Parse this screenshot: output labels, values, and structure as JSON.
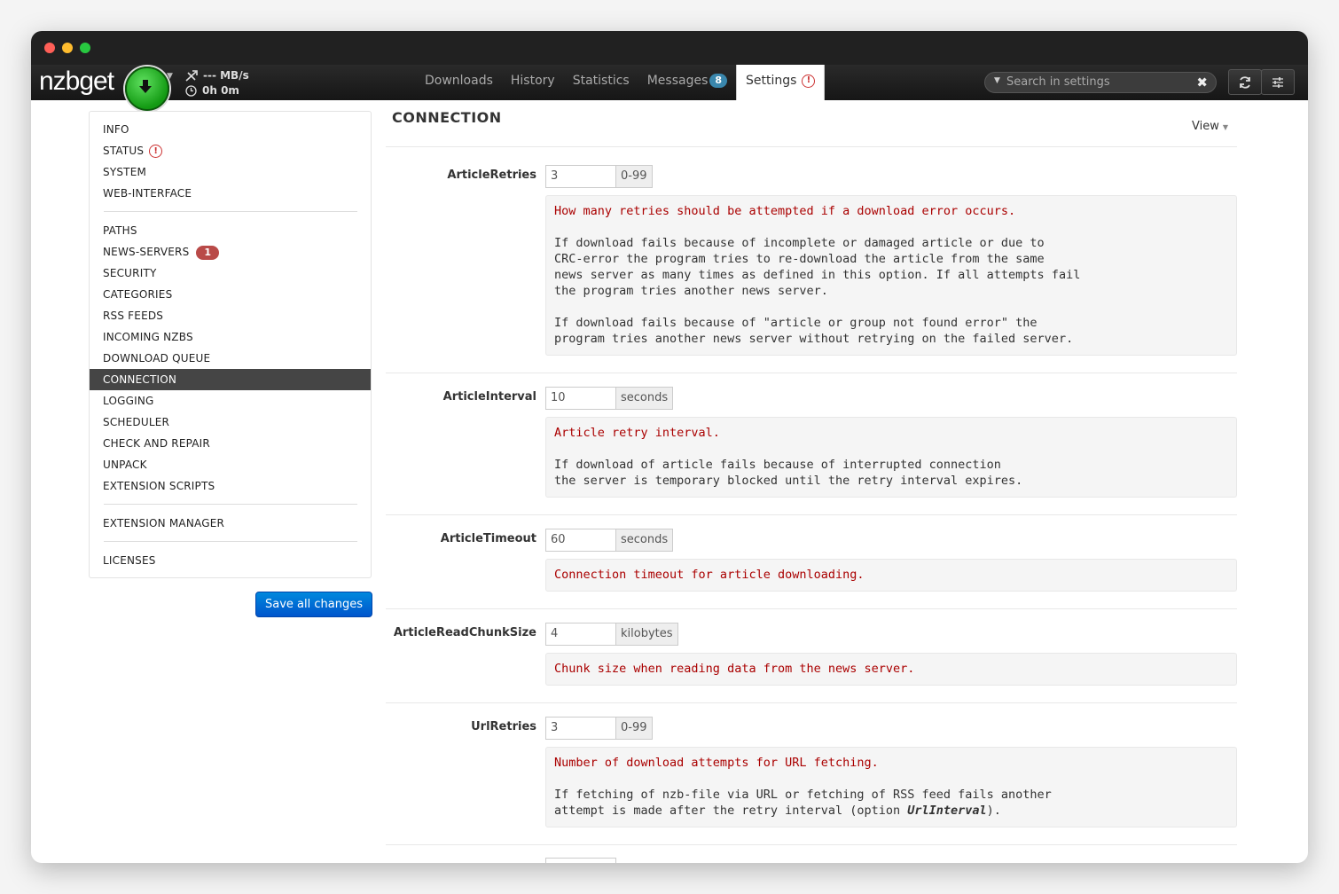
{
  "app": {
    "logo": "nzbget",
    "speed": "--- MB/s",
    "time": "0h 0m"
  },
  "nav": {
    "tabs": [
      {
        "label": "Downloads"
      },
      {
        "label": "History"
      },
      {
        "label": "Statistics"
      },
      {
        "label": "Messages",
        "badge": "8"
      },
      {
        "label": "Settings"
      }
    ],
    "search_placeholder": "Search in settings"
  },
  "sidebar": {
    "items": [
      "INFO",
      "STATUS",
      "SYSTEM",
      "WEB-INTERFACE",
      "PATHS",
      "NEWS-SERVERS",
      "SECURITY",
      "CATEGORIES",
      "RSS FEEDS",
      "INCOMING NZBS",
      "DOWNLOAD QUEUE",
      "CONNECTION",
      "LOGGING",
      "SCHEDULER",
      "CHECK AND REPAIR",
      "UNPACK",
      "EXTENSION SCRIPTS",
      "EXTENSION MANAGER",
      "LICENSES"
    ],
    "news_servers_badge": "1",
    "active": "CONNECTION",
    "save_label": "Save all changes"
  },
  "main": {
    "title": "CONNECTION",
    "view_label": "View",
    "options": [
      {
        "name": "ArticleRetries",
        "value": "3",
        "unit": "0-99",
        "summary": "How many retries should be attempted if a download error occurs.",
        "details": [
          "If download fails because of incomplete or damaged article or due to\nCRC-error the program tries to re-download the article from the same\nnews server as many times as defined in this option. If all attempts fail\nthe program tries another news server.",
          "If download fails because of \"article or group not found error\" the\nprogram tries another news server without retrying on the failed server."
        ]
      },
      {
        "name": "ArticleInterval",
        "value": "10",
        "unit": "seconds",
        "summary": "Article retry interval.",
        "details": [
          "If download of article fails because of interrupted connection\nthe server is temporary blocked until the retry interval expires."
        ]
      },
      {
        "name": "ArticleTimeout",
        "value": "60",
        "unit": "seconds",
        "summary": "Connection timeout for article downloading.",
        "details": []
      },
      {
        "name": "ArticleReadChunkSize",
        "value": "4",
        "unit": "kilobytes",
        "summary": "Chunk size when reading data from the news server.",
        "details": []
      },
      {
        "name": "UrlRetries",
        "value": "3",
        "unit": "0-99",
        "summary": "Number of download attempts for URL fetching.",
        "details_pre": "If fetching of nzb-file via URL or fetching of RSS feed fails another\nattempt is made after the retry interval (option ",
        "details_em": "UrlInterval",
        "details_post": ")."
      }
    ]
  },
  "colors": {
    "accent": "#0066cc",
    "active_sidebar": "#454545",
    "warning": "#cc3333",
    "description_highlight": "#aa0000"
  }
}
